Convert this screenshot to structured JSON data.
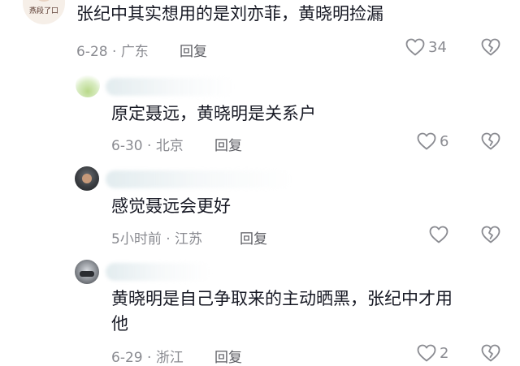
{
  "comments": [
    {
      "avatar_caption": "燕段了口",
      "text": "张纪中其实想用的是刘亦菲，黄晓明捡漏",
      "date": "6-28",
      "location": "广东",
      "reply_label": "回复",
      "likes": "34"
    },
    {
      "text": "原定聂远，黄晓明是关系户",
      "date": "6-30",
      "location": "北京",
      "reply_label": "回复",
      "likes": "6"
    },
    {
      "text": "感觉聂远会更好",
      "date": "5小时前",
      "location": "江苏",
      "reply_label": "回复",
      "likes": ""
    },
    {
      "text_line1": "黄晓明是自己争取来的主动晒黑，张纪中才用",
      "text_line2": "他",
      "date": "6-29",
      "location": "浙江",
      "reply_label": "回复",
      "likes": "2"
    }
  ],
  "meta_separator": " · ",
  "colors": {
    "text": "#161823",
    "meta": "#8a8b91",
    "background": "#ffffff"
  }
}
